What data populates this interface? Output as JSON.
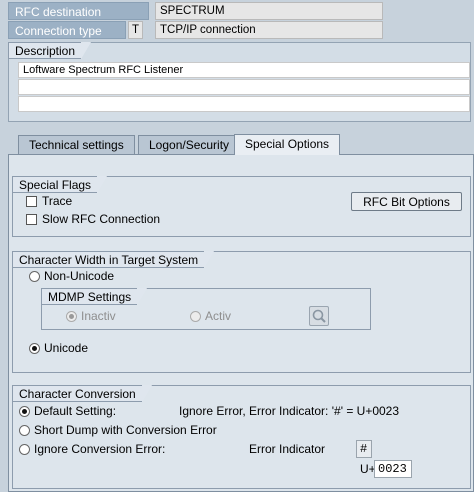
{
  "header": {
    "rfc_destination_label": "RFC destination",
    "rfc_destination_value": "SPECTRUM",
    "connection_type_label": "Connection type",
    "connection_type_code": "T",
    "connection_type_value": "TCP/IP connection"
  },
  "description": {
    "title": "Description",
    "lines": [
      "Loftware Spectrum RFC Listener",
      "",
      ""
    ]
  },
  "tabs": [
    {
      "label": "Technical settings"
    },
    {
      "label": "Logon/Security"
    },
    {
      "label": "Special Options"
    }
  ],
  "special_flags": {
    "title": "Special Flags",
    "trace_label": "Trace",
    "slow_rfc_label": "Slow RFC Connection",
    "rfc_bit_options_label": "RFC Bit Options"
  },
  "char_width": {
    "title": "Character Width in Target System",
    "non_unicode_label": "Non-Unicode",
    "mdmp_title": "MDMP Settings",
    "inactiv_label": "Inactiv",
    "activ_label": "Activ",
    "unicode_label": "Unicode"
  },
  "char_conversion": {
    "title": "Character Conversion",
    "default_label": "Default Setting:",
    "default_desc": "Ignore Error, Error Indicator: '#' = U+0023",
    "short_dump_label": "Short Dump with Conversion Error",
    "ignore_label": "Ignore Conversion Error:",
    "error_indicator_label": "Error Indicator",
    "error_indicator_value": "#",
    "uplus_label": "U+",
    "uplus_value": "0023"
  }
}
